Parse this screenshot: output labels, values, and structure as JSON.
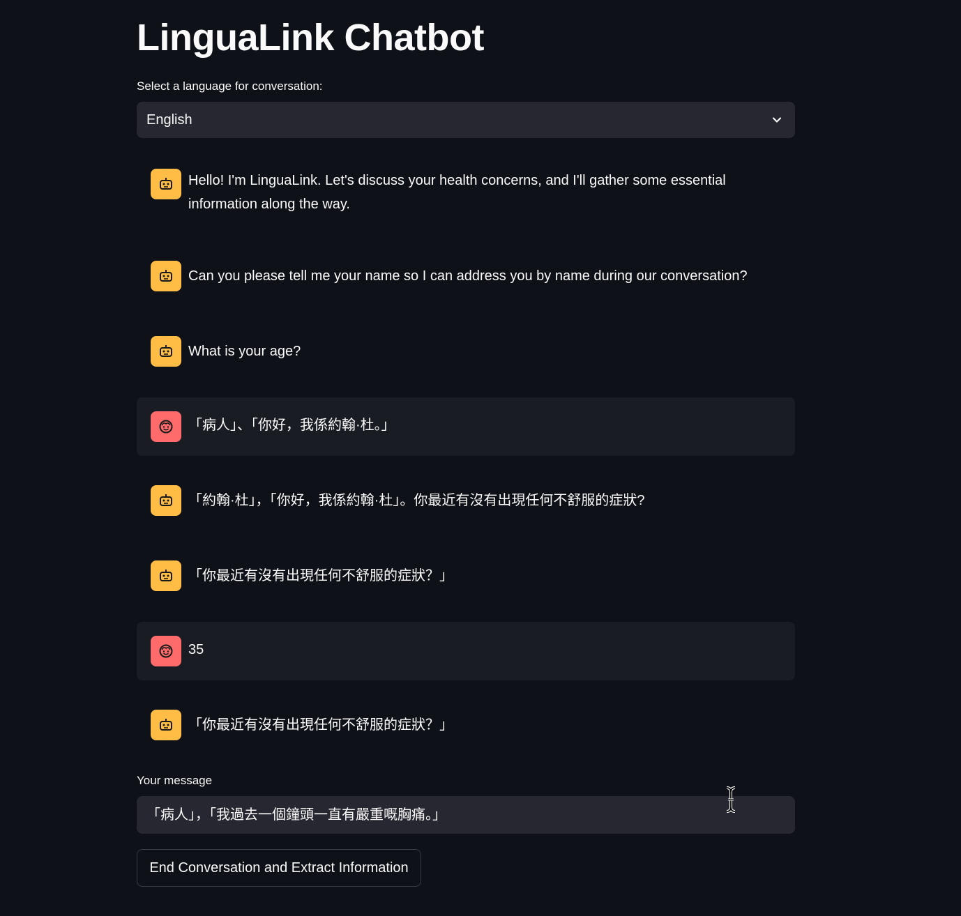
{
  "app": {
    "title": "LinguaLink Chatbot"
  },
  "language_select": {
    "label": "Select a language for conversation:",
    "value": "English"
  },
  "messages": [
    {
      "role": "assistant",
      "text": "Hello! I'm LinguaLink. Let's discuss your health concerns, and I'll gather some essential information along the way."
    },
    {
      "role": "assistant",
      "text": "Can you please tell me your name so I can address you by name during our conversation?"
    },
    {
      "role": "assistant",
      "text": "What is your age?"
    },
    {
      "role": "user",
      "text": "「病人」、「你好，我係約翰·杜。」"
    },
    {
      "role": "assistant",
      "text": "「約翰·杜」，「你好，我係約翰·杜」。你最近有沒有出現任何不舒服的症狀?"
    },
    {
      "role": "assistant",
      "text": "「你最近有沒有出現任何不舒服的症狀？」"
    },
    {
      "role": "user",
      "text": "35"
    },
    {
      "role": "assistant",
      "text": "「你最近有沒有出現任何不舒服的症狀？」"
    }
  ],
  "message_input": {
    "label": "Your message",
    "value": "「病人」，「我過去一個鐘頭一直有嚴重嘅胸痛。」"
  },
  "end_button": {
    "label": "End Conversation and Extract Information"
  },
  "colors": {
    "background": "#0e1117",
    "bot_avatar": "#ffbd45",
    "user_avatar": "#ff6b6b",
    "input_bg": "#262730",
    "user_message_bg": "#1a1c24"
  },
  "icons": {
    "bot_avatar": "robot-face-icon",
    "user_avatar": "smiling-face-icon",
    "select_toggle": "chevron-down-icon",
    "mouse_cursor": "text-cursor-icon"
  }
}
